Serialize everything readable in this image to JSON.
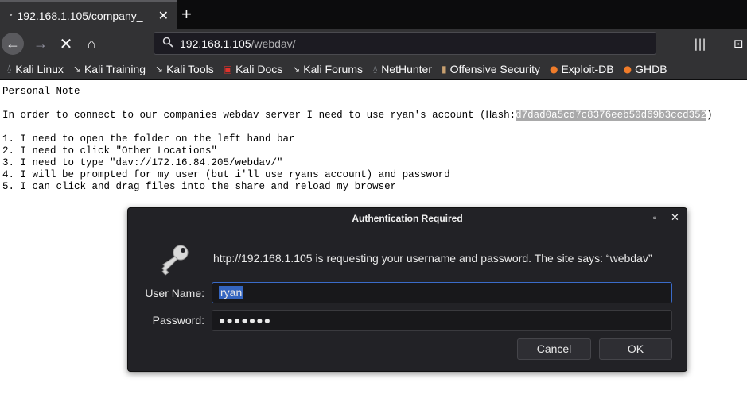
{
  "tab": {
    "title": "192.168.1.105/company_",
    "dot": "•",
    "close": "✕",
    "new": "+"
  },
  "nav": {
    "back": "←",
    "forward": "→",
    "stop": "✕",
    "home": "⌂",
    "library": "|||",
    "sidebar": "⊡"
  },
  "url": {
    "host": "192.168.1.105",
    "path": "/webdav/"
  },
  "bookmarks": [
    {
      "label": "Kali Linux",
      "icon": "⍙"
    },
    {
      "label": "Kali Training",
      "icon": "↘"
    },
    {
      "label": "Kali Tools",
      "icon": "↘"
    },
    {
      "label": "Kali Docs",
      "icon": "▣"
    },
    {
      "label": "Kali Forums",
      "icon": "↘"
    },
    {
      "label": "NetHunter",
      "icon": "⍙"
    },
    {
      "label": "Offensive Security",
      "icon": "▮"
    },
    {
      "label": "Exploit-DB",
      "icon": "●"
    },
    {
      "label": "GHDB",
      "icon": "●"
    }
  ],
  "page": {
    "heading": "Personal Note",
    "intro_prefix": "In order to connect to our companies webdav server I need to use ryan's account (Hash:",
    "hash": "d7dad0a5cd7c8376eeb50d69b3ccd352",
    "intro_suffix": ")",
    "steps": [
      "1. I need to open the folder on the left hand bar",
      "2. I need to click \"Other Locations\"",
      "3. I need to type \"dav://172.16.84.205/webdav/\"",
      "4. I will be prompted for my user (but i'll use ryans account) and password",
      "5. I can click and drag files into the share and reload my browser"
    ]
  },
  "dialog": {
    "title": "Authentication Required",
    "message": "http://192.168.1.105 is requesting your username and password. The site says: “webdav”",
    "username_label": "User Name:",
    "username_value": "ryan",
    "password_label": "Password:",
    "password_masked": "●●●●●●●",
    "cancel": "Cancel",
    "ok": "OK",
    "maximize": "▫",
    "close": "✕"
  },
  "colors": {
    "chrome": "#323234",
    "tabbar": "#0c0c0d",
    "dialog": "#222226",
    "focus": "#3465c0"
  }
}
